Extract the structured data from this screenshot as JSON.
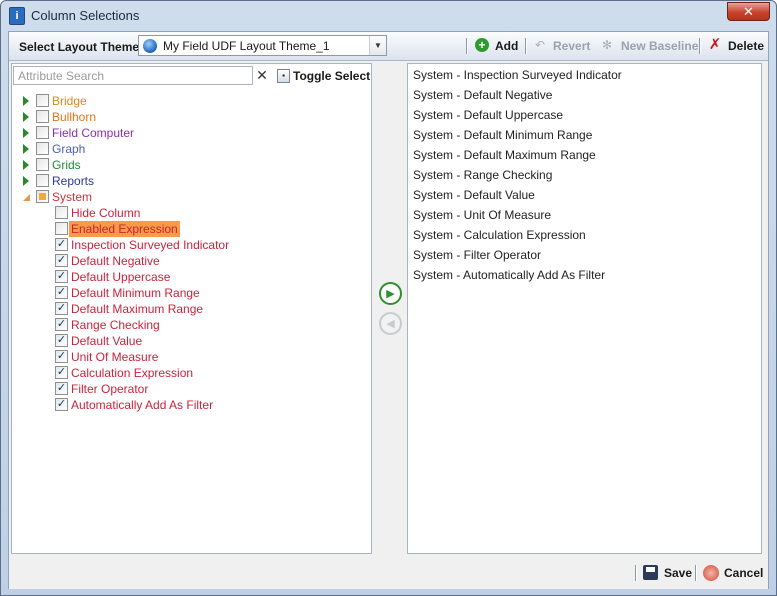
{
  "window": {
    "title": "Column Selections",
    "close_glyph": "✕"
  },
  "toolbar": {
    "theme_label": "Select Layout Theme",
    "theme_value": "My Field UDF Layout Theme_1",
    "add_label": "Add",
    "revert_label": "Revert",
    "baseline_label": "New Baseline",
    "delete_label": "Delete"
  },
  "search": {
    "placeholder": "Attribute Search",
    "value": ""
  },
  "toggle_select_label": "Toggle Select",
  "tree": {
    "groups": [
      {
        "label": "Bridge",
        "color": "#d88a1a"
      },
      {
        "label": "Bullhorn",
        "color": "#e2741b"
      },
      {
        "label": "Field Computer",
        "color": "#8a2fb0"
      },
      {
        "label": "Graph",
        "color": "#4a5fb0"
      },
      {
        "label": "Grids",
        "color": "#1f8a3a"
      },
      {
        "label": "Reports",
        "color": "#2a3a9a"
      },
      {
        "label": "System",
        "color": "#c8343c"
      }
    ],
    "system_children": [
      {
        "label": "Hide Column",
        "checked": false
      },
      {
        "label": "Enabled Expression",
        "checked": false
      },
      {
        "label": "Inspection Surveyed Indicator",
        "checked": true
      },
      {
        "label": "Default Negative",
        "checked": true
      },
      {
        "label": "Default Uppercase",
        "checked": true
      },
      {
        "label": "Default Minimum Range",
        "checked": true
      },
      {
        "label": "Default Maximum Range",
        "checked": true
      },
      {
        "label": "Range Checking",
        "checked": true
      },
      {
        "label": "Default Value",
        "checked": true
      },
      {
        "label": "Unit Of Measure",
        "checked": true
      },
      {
        "label": "Calculation Expression",
        "checked": true
      },
      {
        "label": "Filter Operator",
        "checked": true
      },
      {
        "label": "Automatically Add As Filter",
        "checked": true
      }
    ],
    "child_color": "#c8243c",
    "highlight_color": "#f99a46"
  },
  "selected": [
    "System - Inspection Surveyed Indicator",
    "System - Default Negative",
    "System - Default Uppercase",
    "System - Default Minimum Range",
    "System - Default Maximum Range",
    "System - Range Checking",
    "System - Default Value",
    "System - Unit Of Measure",
    "System - Calculation Expression",
    "System - Filter Operator",
    "System - Automatically Add As Filter"
  ],
  "footer": {
    "save_label": "Save",
    "cancel_label": "Cancel"
  }
}
